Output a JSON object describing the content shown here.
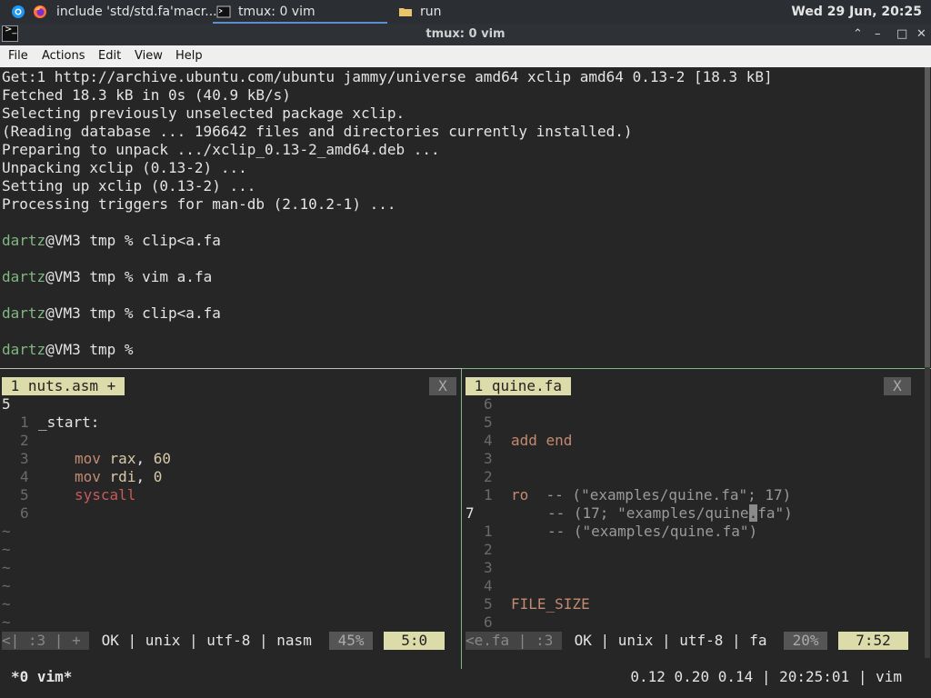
{
  "topbar": {
    "tab1_label": "include 'std/std.fa'macr...",
    "tab2_label": "tmux: 0 vim",
    "tab3_label": "run",
    "clock": "Wed 29 Jun, 20:25"
  },
  "window": {
    "title": "tmux: 0 vim",
    "minimize": "^",
    "restore": "–",
    "maximize": "□",
    "close": "✕",
    "app_icon": "terminal-icon"
  },
  "menu": {
    "file": "File",
    "actions": "Actions",
    "edit": "Edit",
    "view": "View",
    "help": "Help"
  },
  "terminal": {
    "lines": [
      "Get:1 http://archive.ubuntu.com/ubuntu jammy/universe amd64 xclip amd64 0.13-2 [18.3 kB]",
      "Fetched 18.3 kB in 0s (40.9 kB/s)",
      "Selecting previously unselected package xclip.",
      "(Reading database ... 196642 files and directories currently installed.)",
      "Preparing to unpack .../xclip_0.13-2_amd64.deb ...",
      "Unpacking xclip (0.13-2) ...",
      "Setting up xclip (0.13-2) ...",
      "Processing triggers for man-db (2.10.2-1) ..."
    ],
    "prompt_user": "dartz",
    "prompt_rest": "@VM3 tmp % ",
    "commands": [
      "clip<a.fa",
      "vim a.fa",
      "clip<a.fa",
      ""
    ]
  },
  "left_pane": {
    "tab": " 1 nuts.asm + ",
    "close": "X",
    "top_line_num": "5",
    "rel_nums": [
      "1",
      "2",
      "3",
      "4",
      "5",
      "6"
    ],
    "label": "_start:",
    "instr1": "mov",
    "instr1_args_reg": "rax",
    "instr1_args_val": "60",
    "instr2": "mov",
    "instr2_args_reg": "rdi",
    "instr2_args_val": "0",
    "syscall": "syscall",
    "tildes": [
      "~",
      "~",
      "~",
      "~",
      "~",
      "~"
    ],
    "status_a": "<| :3 | + ",
    "status_b": " OK | unix | utf-8 | nasm ",
    "status_pct": " 45% ",
    "status_pos": "  5:0  "
  },
  "right_pane": {
    "tab": " 1 quine.fa ",
    "close": "X",
    "rel_nums": [
      "6",
      "5",
      "4",
      "3",
      "2",
      "1",
      "7",
      "1",
      "2",
      "3",
      "4",
      "5",
      "6"
    ],
    "add_end": "add end",
    "ro": "ro",
    "ro_comment": "-- (\"examples/quine.fa\"; 17)",
    "cmt2": "-- (17; \"examples/quine",
    "cmt2_cursor": ".",
    "cmt2_tail": "fa\")",
    "cmt3": "-- (\"examples/quine.fa\")",
    "file_size": "FILE_SIZE",
    "status_a": "<e.fa | :3 ",
    "status_b": " OK | unix | utf-8 | fa ",
    "status_pct": " 20% ",
    "status_pos": "  7:52  "
  },
  "tmux": {
    "window": "*0 vim*",
    "right": "0.12 0.20 0.14 | 20:25:01 | vim"
  }
}
